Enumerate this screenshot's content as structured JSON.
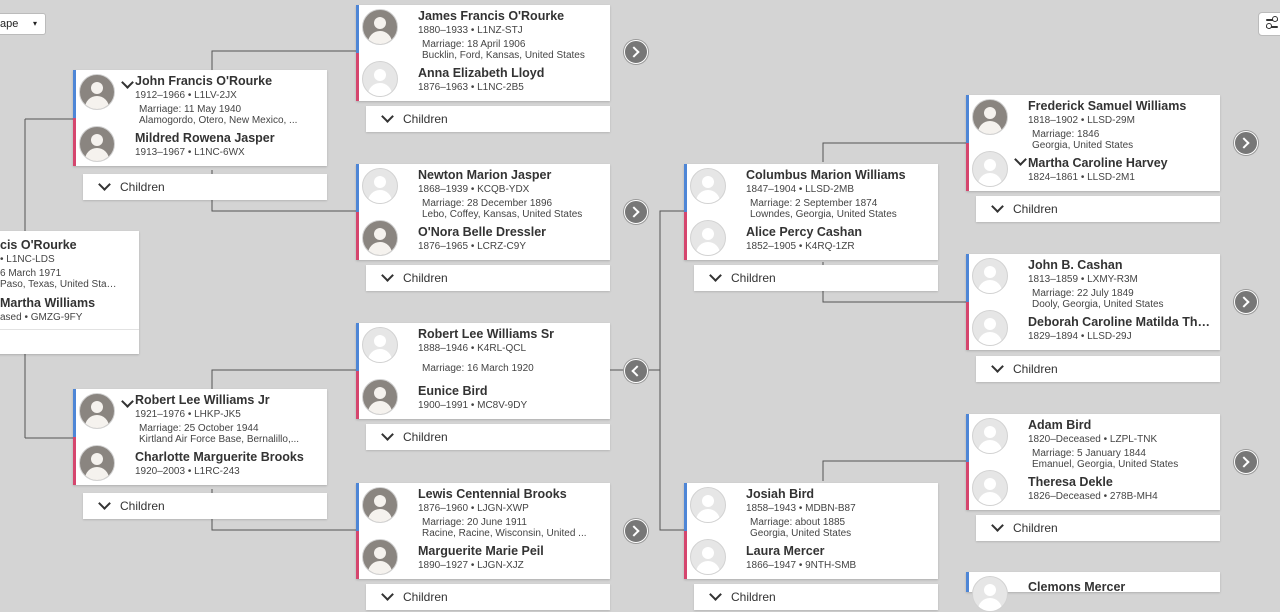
{
  "toolbar": {
    "view_select_value": "ape",
    "view_select_arrow": "▾",
    "settings_icon": "sliders-icon"
  },
  "children_label": "Children",
  "root": {
    "husband": {
      "name": "cis O'Rourke",
      "lifespan": "• L1NC-LDS"
    },
    "marriage_line1": "6 March 1971",
    "marriage_line2": "Paso, Texas, United Sta…",
    "wife": {
      "name": "Martha Williams",
      "lifespan": "ased • GMZG-9FY"
    }
  },
  "couples": [
    {
      "id": "obrien-lloyd",
      "husband": {
        "name": "James Francis O'Rourke",
        "lifespan": "1880–1933 • L1NZ-STJ",
        "photo": true
      },
      "marriage_line1": "Marriage: 18 April 1906",
      "marriage_line2": "Bucklin, Ford, Kansas, United States",
      "wife": {
        "name": "Anna Elizabeth Lloyd",
        "lifespan": "1876–1963 • L1NC-2B5",
        "photo": false
      }
    },
    {
      "id": "john-mildred",
      "husband": {
        "name": "John Francis O'Rourke",
        "lifespan": "1912–1966 • L1LV-2JX",
        "photo": true
      },
      "marriage_line1": "Marriage: 11 May 1940",
      "marriage_line2": "Alamogordo, Otero, New Mexico, ...",
      "wife": {
        "name": "Mildred Rowena Jasper",
        "lifespan": "1913–1967 • L1NC-6WX",
        "photo": true
      }
    },
    {
      "id": "jasper-dressler",
      "husband": {
        "name": "Newton Marion Jasper",
        "lifespan": "1868–1939 • KCQB-YDX",
        "photo": false
      },
      "marriage_line1": "Marriage: 28 December 1896",
      "marriage_line2": "Lebo, Coffey, Kansas, United States",
      "wife": {
        "name": "O'Nora Belle Dressler",
        "lifespan": "1876–1965 • LCRZ-C9Y",
        "photo": true
      }
    },
    {
      "id": "williams-bird",
      "husband": {
        "name": "Robert Lee Williams Sr",
        "lifespan": "1888–1946 • K4RL-QCL",
        "photo": false
      },
      "marriage_line1": "Marriage: 16 March 1920",
      "marriage_line2": "",
      "wife": {
        "name": "Eunice Bird",
        "lifespan": "1900–1991 • MC8V-9DY",
        "photo": true
      }
    },
    {
      "id": "robertjr-charlotte",
      "husband": {
        "name": "Robert Lee Williams Jr",
        "lifespan": "1921–1976 • LHKP-JK5",
        "photo": true
      },
      "marriage_line1": "Marriage: 25 October 1944",
      "marriage_line2": "Kirtland Air Force Base, Bernalillo,...",
      "wife": {
        "name": "Charlotte Marguerite Brooks",
        "lifespan": "1920–2003 • L1RC-243",
        "photo": true
      }
    },
    {
      "id": "brooks-peil",
      "husband": {
        "name": "Lewis Centennial Brooks",
        "lifespan": "1876–1960 • LJGN-XWP",
        "photo": true
      },
      "marriage_line1": "Marriage: 20 June 1911",
      "marriage_line2": "Racine, Racine, Wisconsin, United ...",
      "wife": {
        "name": "Marguerite Marie Peil",
        "lifespan": "1890–1927 • LJGN-XJZ",
        "photo": true
      }
    },
    {
      "id": "columbus-alice",
      "husband": {
        "name": "Columbus Marion Williams",
        "lifespan": "1847–1904 • LLSD-2MB",
        "photo": false
      },
      "marriage_line1": "Marriage: 2 September 1874",
      "marriage_line2": "Lowndes, Georgia, United States",
      "wife": {
        "name": "Alice Percy Cashan",
        "lifespan": "1852–1905 • K4RQ-1ZR",
        "photo": false
      }
    },
    {
      "id": "josiah-laura",
      "husband": {
        "name": "Josiah Bird",
        "lifespan": "1858–1943 • MDBN-B87",
        "photo": false
      },
      "marriage_line1": "Marriage: about 1885",
      "marriage_line2": "Georgia, United States",
      "wife": {
        "name": "Laura Mercer",
        "lifespan": "1866–1947 • 9NTH-SMB",
        "photo": false
      }
    },
    {
      "id": "frederick-martha",
      "husband": {
        "name": "Frederick Samuel Williams",
        "lifespan": "1818–1902 • LLSD-29M",
        "photo": true
      },
      "marriage_line1": "Marriage: 1846",
      "marriage_line2": "Georgia, United States",
      "wife": {
        "name": "Martha Caroline Harvey",
        "lifespan": "1824–1861 • LLSD-2M1",
        "photo": false
      }
    },
    {
      "id": "cashan-deborah",
      "husband": {
        "name": "John B. Cashan",
        "lifespan": "1813–1859 • LXMY-R3M",
        "photo": false
      },
      "marriage_line1": "Marriage: 22 July 1849",
      "marriage_line2": "Dooly, Georgia, United States",
      "wife": {
        "name": "Deborah Caroline Matilda Tha…",
        "lifespan": "1829–1894 • LLSD-29J",
        "photo": false
      }
    },
    {
      "id": "adam-theresa",
      "husband": {
        "name": "Adam Bird",
        "lifespan": "1820–Deceased • LZPL-TNK",
        "photo": false
      },
      "marriage_line1": "Marriage: 5 January 1844",
      "marriage_line2": "Emanuel, Georgia, United States",
      "wife": {
        "name": "Theresa Dekle",
        "lifespan": "1826–Deceased • 278B-MH4",
        "photo": false
      }
    }
  ],
  "partial": {
    "clemons": {
      "name": "Clemons Mercer"
    }
  },
  "colors": {
    "background": "#d4d4d4",
    "male": "#4e86d6",
    "female": "#d5466e",
    "nav_button": "#777777"
  }
}
